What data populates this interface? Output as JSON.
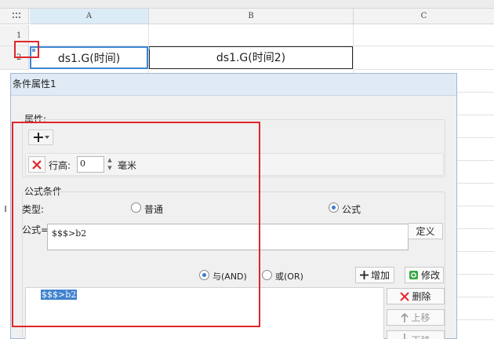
{
  "sheet": {
    "columns": [
      "A",
      "B",
      "C"
    ],
    "rows": [
      "1",
      "2"
    ],
    "cells": {
      "a2": "ds1.G(时间)",
      "b2": "ds1.G(时间2)"
    }
  },
  "dialog": {
    "title": "条件属性1",
    "properties": {
      "label": "属性:",
      "add_icon": "plus-dropdown-icon",
      "delete_icon": "red-x-icon",
      "row_height_label": "行高:",
      "row_height_value": "0",
      "unit": "毫米"
    },
    "formula_condition": {
      "label": "公式条件",
      "type_label": "类型:",
      "type_options": [
        "普通",
        "公式"
      ],
      "selected_type": "公式",
      "formula_label": "公式=",
      "formula_value": "$$$>b2",
      "define_button": "定义",
      "logic_options": [
        "与(AND)",
        "或(OR)"
      ],
      "selected_logic": "与(AND)",
      "add_button": "增加",
      "modify_button": "修改",
      "condition_list": [
        "$$$>b2"
      ],
      "delete_button": "删除",
      "move_up_button": "上移",
      "move_down_button": "下移"
    },
    "colors": {
      "selection_blue": "#3d86d6",
      "annotation_red": "#e0262a",
      "list_highlight": "#3f82cf"
    }
  }
}
